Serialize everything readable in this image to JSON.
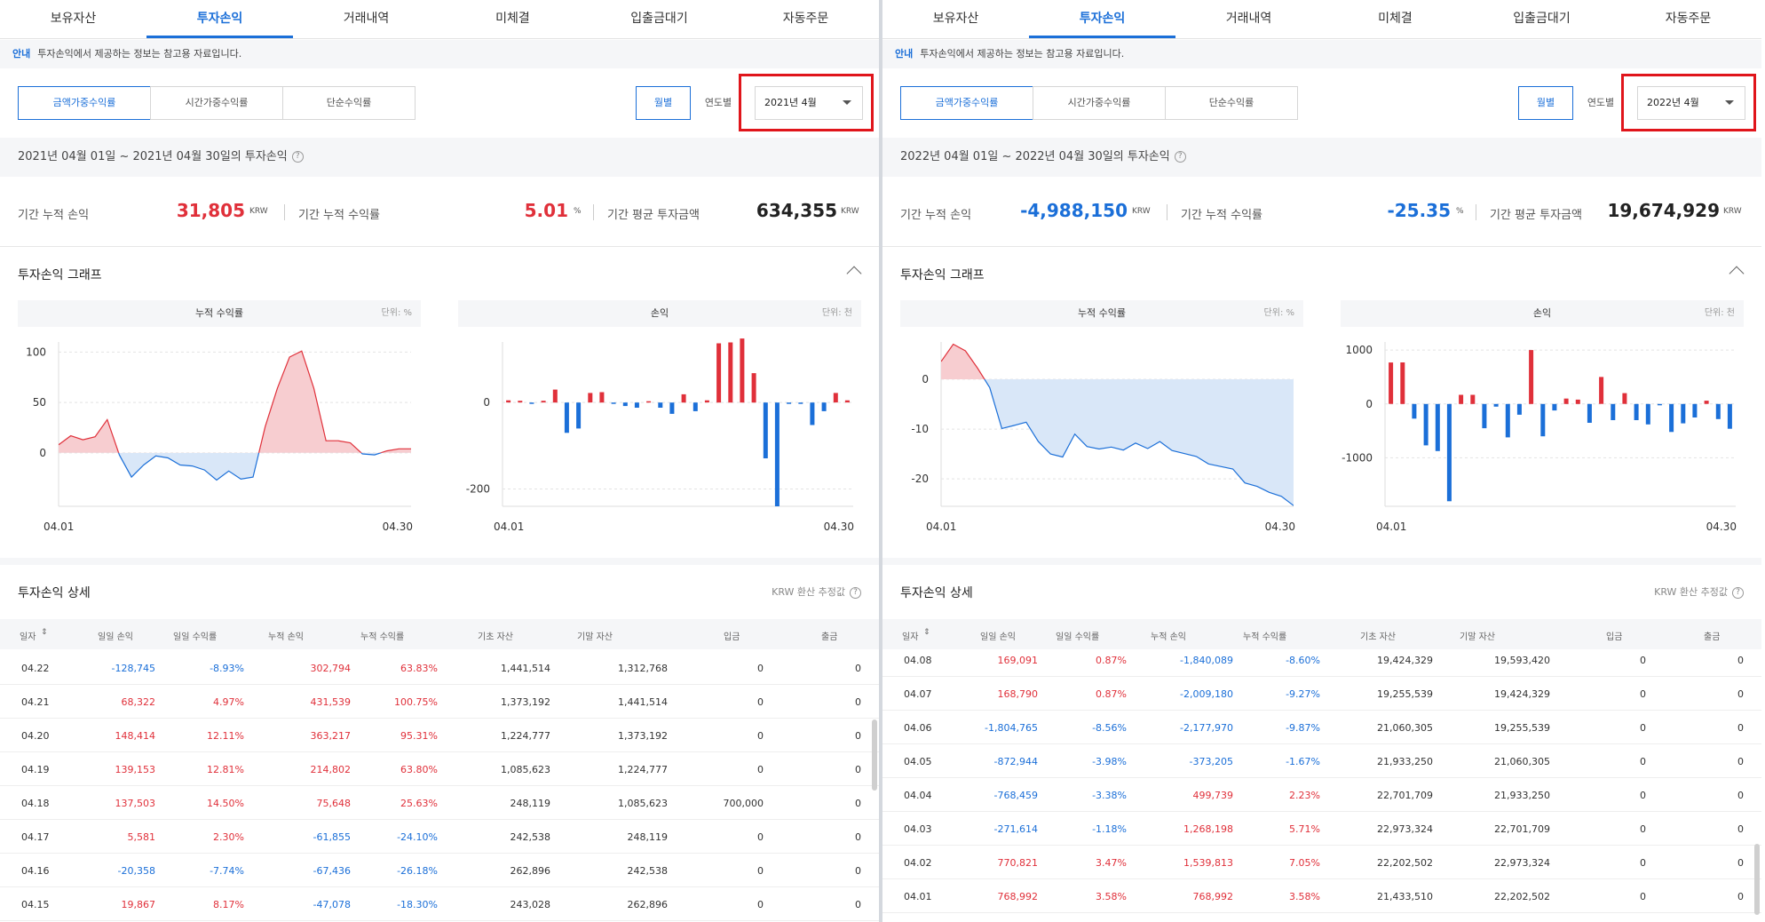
{
  "panels": [
    {
      "tabs": [
        "보유자산",
        "투자손익",
        "거래내역",
        "미체결",
        "입출금대기",
        "자동주문"
      ],
      "active_tab": 1,
      "notice": {
        "label": "안내",
        "text": "투자손익에서 제공하는 정보는 참고용 자료입니다."
      },
      "rate_types": [
        "금액가중수익률",
        "시간가중수익률",
        "단순수익률"
      ],
      "period_buttons": [
        "월별",
        "연도별"
      ],
      "month": "2021년 4월",
      "period_text": "2021년 04월 01일 ~ 2021년 04월 30일의 투자손익",
      "summary": {
        "pl_label": "기간 누적 손익",
        "pl_value": "31,805",
        "pl_unit": "KRW",
        "rate_label": "기간 누적 수익률",
        "rate_value": "5.01",
        "rate_unit": "%",
        "avg_label": "기간 평균 투자금액",
        "avg_value": "634,355",
        "avg_unit": "KRW"
      },
      "graph_title": "투자손익 그래프",
      "charts": {
        "cum": {
          "title": "누적 수익률",
          "unit": "단위: %",
          "yticks": [
            "100",
            "50",
            "0"
          ],
          "x_start": "04.01",
          "x_end": "04.30"
        },
        "pl": {
          "title": "손익",
          "unit": "단위: 천",
          "yticks": [
            "0",
            "-200"
          ],
          "x_start": "04.01",
          "x_end": "04.30"
        }
      },
      "detail_title": "투자손익 상세",
      "krw_note": "KRW 환산 추정값",
      "headers": [
        "일자",
        "일일 손익",
        "일일 수익률",
        "누적 손익",
        "누적 수익률",
        "기초 자산",
        "기말 자산",
        "입금",
        "출금"
      ],
      "rows": [
        [
          "04.22",
          "-128,745",
          "-8.93%",
          "302,794",
          "63.83%",
          "1,441,514",
          "1,312,768",
          "0",
          "0"
        ],
        [
          "04.21",
          "68,322",
          "4.97%",
          "431,539",
          "100.75%",
          "1,373,192",
          "1,441,514",
          "0",
          "0"
        ],
        [
          "04.20",
          "148,414",
          "12.11%",
          "363,217",
          "95.31%",
          "1,224,777",
          "1,373,192",
          "0",
          "0"
        ],
        [
          "04.19",
          "139,153",
          "12.81%",
          "214,802",
          "63.80%",
          "1,085,623",
          "1,224,777",
          "0",
          "0"
        ],
        [
          "04.18",
          "137,503",
          "14.50%",
          "75,648",
          "25.63%",
          "248,119",
          "1,085,623",
          "700,000",
          "0"
        ],
        [
          "04.17",
          "5,581",
          "2.30%",
          "-61,855",
          "-24.10%",
          "242,538",
          "248,119",
          "0",
          "0"
        ],
        [
          "04.16",
          "-20,358",
          "-7.74%",
          "-67,436",
          "-26.18%",
          "262,896",
          "242,538",
          "0",
          "0"
        ],
        [
          "04.15",
          "19,867",
          "8.17%",
          "-47,078",
          "-18.30%",
          "243,028",
          "262,896",
          "0",
          "0"
        ]
      ]
    },
    {
      "tabs": [
        "보유자산",
        "투자손익",
        "거래내역",
        "미체결",
        "입출금대기",
        "자동주문"
      ],
      "active_tab": 1,
      "notice": {
        "label": "안내",
        "text": "투자손익에서 제공하는 정보는 참고용 자료입니다."
      },
      "rate_types": [
        "금액가중수익률",
        "시간가중수익률",
        "단순수익률"
      ],
      "period_buttons": [
        "월별",
        "연도별"
      ],
      "month": "2022년 4월",
      "period_text": "2022년 04월 01일 ~ 2022년 04월 30일의 투자손익",
      "summary": {
        "pl_label": "기간 누적 손익",
        "pl_value": "-4,988,150",
        "pl_unit": "KRW",
        "rate_label": "기간 누적 수익률",
        "rate_value": "-25.35",
        "rate_unit": "%",
        "avg_label": "기간 평균 투자금액",
        "avg_value": "19,674,929",
        "avg_unit": "KRW"
      },
      "graph_title": "투자손익 그래프",
      "charts": {
        "cum": {
          "title": "누적 수익률",
          "unit": "단위: %",
          "yticks": [
            "0",
            "-10",
            "-20"
          ],
          "x_start": "04.01",
          "x_end": "04.30"
        },
        "pl": {
          "title": "손익",
          "unit": "단위: 천",
          "yticks": [
            "1000",
            "0",
            "-1000"
          ],
          "x_start": "04.01",
          "x_end": "04.30"
        }
      },
      "detail_title": "투자손익 상세",
      "krw_note": "KRW 환산 추정값",
      "headers": [
        "일자",
        "일일 손익",
        "일일 수익률",
        "누적 손익",
        "누적 수익률",
        "기초 자산",
        "기말 자산",
        "입금",
        "출금"
      ],
      "rows": [
        [
          "04.08",
          "169,091",
          "0.87%",
          "-1,840,089",
          "-8.60%",
          "19,424,329",
          "19,593,420",
          "0",
          "0"
        ],
        [
          "04.07",
          "168,790",
          "0.87%",
          "-2,009,180",
          "-9.27%",
          "19,255,539",
          "19,424,329",
          "0",
          "0"
        ],
        [
          "04.06",
          "-1,804,765",
          "-8.56%",
          "-2,177,970",
          "-9.87%",
          "21,060,305",
          "19,255,539",
          "0",
          "0"
        ],
        [
          "04.05",
          "-872,944",
          "-3.98%",
          "-373,205",
          "-1.67%",
          "21,933,250",
          "21,060,305",
          "0",
          "0"
        ],
        [
          "04.04",
          "-768,459",
          "-3.38%",
          "499,739",
          "2.23%",
          "22,701,709",
          "21,933,250",
          "0",
          "0"
        ],
        [
          "04.03",
          "-271,614",
          "-1.18%",
          "1,268,198",
          "5.71%",
          "22,973,324",
          "22,701,709",
          "0",
          "0"
        ],
        [
          "04.02",
          "770,821",
          "3.47%",
          "1,539,813",
          "7.05%",
          "22,202,502",
          "22,973,324",
          "0",
          "0"
        ],
        [
          "04.01",
          "768,992",
          "3.58%",
          "768,992",
          "3.58%",
          "21,433,510",
          "22,202,502",
          "0",
          "0"
        ]
      ]
    }
  ],
  "chart_data": [
    {
      "type": "area",
      "title": "누적 수익률",
      "ylabel": "단위: %",
      "ylim": [
        -53,
        110
      ],
      "yticks": [
        100,
        50,
        0
      ],
      "x": [
        "04.01",
        "04.02",
        "04.03",
        "04.04",
        "04.05",
        "04.06",
        "04.07",
        "04.08",
        "04.09",
        "04.10",
        "04.11",
        "04.12",
        "04.13",
        "04.14",
        "04.15",
        "04.16",
        "04.17",
        "04.18",
        "04.19",
        "04.20",
        "04.21",
        "04.22",
        "04.23",
        "04.24",
        "04.25",
        "04.26",
        "04.27",
        "04.28",
        "04.29",
        "04.30"
      ],
      "values": [
        8,
        17,
        13,
        16,
        33,
        -2,
        -24,
        -12,
        -3,
        -5,
        -12,
        -13,
        -17,
        -27,
        -18,
        -26,
        -24,
        26,
        64,
        95,
        101,
        64,
        12,
        12,
        10,
        -1,
        -2,
        2,
        4,
        4
      ]
    },
    {
      "type": "bar",
      "title": "손익",
      "ylabel": "단위: 천",
      "ylim": [
        -240,
        140
      ],
      "yticks": [
        0,
        -200
      ],
      "x": [
        "04.01",
        "04.02",
        "04.03",
        "04.04",
        "04.05",
        "04.06",
        "04.07",
        "04.08",
        "04.09",
        "04.10",
        "04.11",
        "04.12",
        "04.13",
        "04.14",
        "04.15",
        "04.16",
        "04.17",
        "04.18",
        "04.19",
        "04.20",
        "04.21",
        "04.22",
        "04.23",
        "04.24",
        "04.25",
        "04.26",
        "04.27",
        "04.28",
        "04.29",
        "04.30"
      ],
      "values": [
        5,
        4,
        -2,
        4,
        30,
        -70,
        -60,
        22,
        24,
        -3,
        -8,
        -12,
        3,
        -12,
        -26,
        19,
        -20,
        5,
        137,
        139,
        148,
        68,
        -129,
        -240,
        -3,
        -3,
        -52,
        -20,
        22,
        5
      ]
    },
    {
      "type": "area",
      "title": "누적 수익률",
      "ylabel": "단위: %",
      "ylim": [
        -25.5,
        7.5
      ],
      "yticks": [
        0,
        -10,
        -20
      ],
      "x": [
        "04.01",
        "04.02",
        "04.03",
        "04.04",
        "04.05",
        "04.06",
        "04.07",
        "04.08",
        "04.09",
        "04.10",
        "04.11",
        "04.12",
        "04.13",
        "04.14",
        "04.15",
        "04.16",
        "04.17",
        "04.18",
        "04.19",
        "04.20",
        "04.21",
        "04.22",
        "04.23",
        "04.24",
        "04.25",
        "04.26",
        "04.27",
        "04.28",
        "04.29",
        "04.30"
      ],
      "values": [
        3.58,
        7.05,
        5.71,
        2.23,
        -1.67,
        -9.87,
        -9.27,
        -8.6,
        -12.5,
        -15,
        -15.6,
        -11,
        -13.5,
        -14,
        -13.6,
        -14.2,
        -12.8,
        -13.9,
        -12.5,
        -14.3,
        -14.9,
        -15.5,
        -17,
        -17.5,
        -18,
        -20.8,
        -21.5,
        -22.7,
        -23.5,
        -25.35
      ]
    },
    {
      "type": "bar",
      "title": "손익",
      "ylabel": "단위: 천",
      "ylim": [
        -1900,
        1150
      ],
      "yticks": [
        1000,
        0,
        -1000
      ],
      "x": [
        "04.01",
        "04.02",
        "04.03",
        "04.04",
        "04.05",
        "04.06",
        "04.07",
        "04.08",
        "04.09",
        "04.10",
        "04.11",
        "04.12",
        "04.13",
        "04.14",
        "04.15",
        "04.16",
        "04.17",
        "04.18",
        "04.19",
        "04.20",
        "04.21",
        "04.22",
        "04.23",
        "04.24",
        "04.25",
        "04.26",
        "04.27",
        "04.28",
        "04.29",
        "04.30"
      ],
      "values": [
        769,
        771,
        -272,
        -768,
        -873,
        -1805,
        169,
        169,
        -450,
        -50,
        -620,
        -200,
        1000,
        -600,
        -120,
        100,
        80,
        -350,
        500,
        -300,
        200,
        -300,
        -380,
        -20,
        -520,
        -360,
        -250,
        60,
        -280,
        -460
      ]
    }
  ],
  "colors": {
    "accent": "#1b6fd8",
    "positive": "#e0303a",
    "negative": "#1b6fd8",
    "highlight_box": "#e0151b"
  }
}
